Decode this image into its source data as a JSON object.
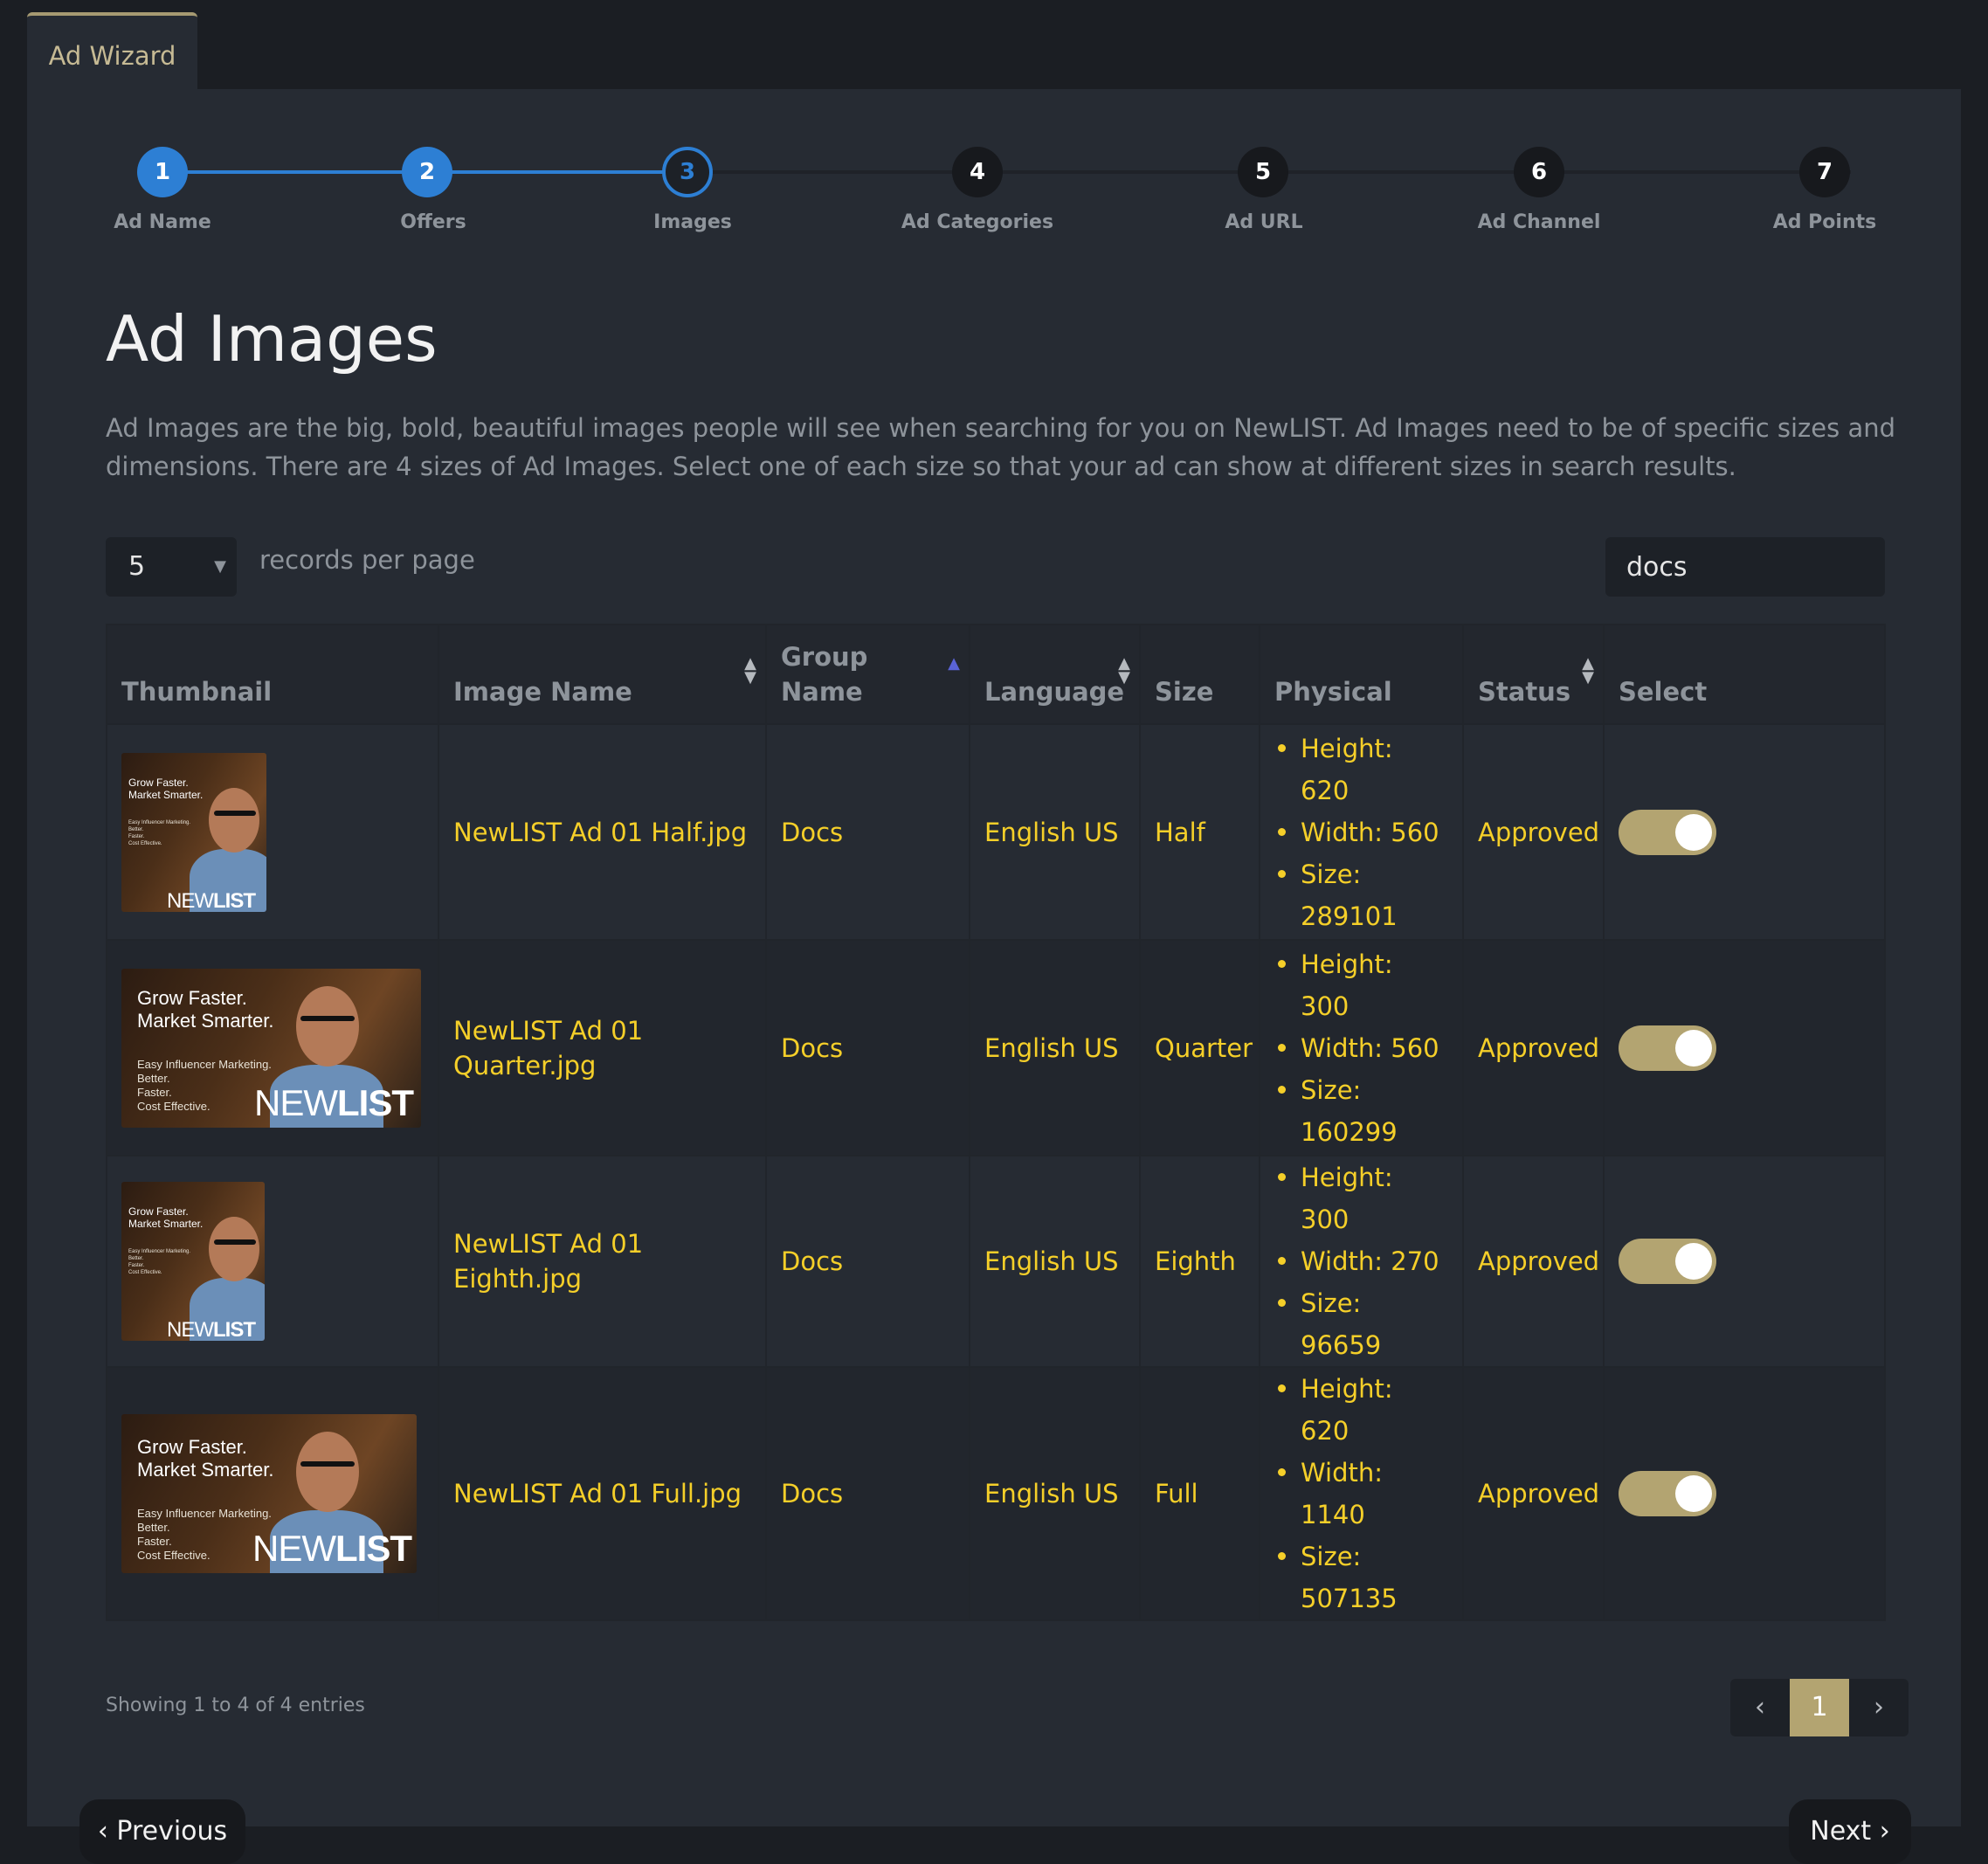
{
  "tab": {
    "label": "Ad Wizard"
  },
  "stepper": {
    "steps": [
      {
        "number": "1",
        "label": "Ad Name"
      },
      {
        "number": "2",
        "label": "Offers"
      },
      {
        "number": "3",
        "label": "Images"
      },
      {
        "number": "4",
        "label": "Ad Categories"
      },
      {
        "number": "5",
        "label": "Ad URL"
      },
      {
        "number": "6",
        "label": "Ad Channel"
      },
      {
        "number": "7",
        "label": "Ad Points"
      }
    ],
    "current_step": 3
  },
  "page": {
    "title": "Ad Images",
    "description": "Ad Images are the big, bold, beautiful images people will see when searching for you on NewLIST. Ad Images need to be of specific sizes and dimensions. There are 4 sizes of Ad Images. Select one of each size so that your ad can show at different sizes in search results."
  },
  "controls": {
    "records_per_page": "5",
    "records_per_page_label": "records per page",
    "search_value": "docs"
  },
  "table": {
    "columns": [
      "Thumbnail",
      "Image Name",
      "Group Name",
      "Language",
      "Size",
      "Physical",
      "Status",
      "Select"
    ],
    "rows": [
      {
        "image_name": "NewLIST Ad 01 Half.jpg",
        "group": "Docs",
        "language": "English US",
        "size": "Half",
        "physical": [
          "Height: 620",
          "Width: 560",
          "Size: 289101"
        ],
        "status": "Approved",
        "selected": true,
        "thumb": {
          "headline_1": "Grow Faster.",
          "headline_2": "Market Smarter.",
          "body": [
            "Easy Influencer Marketing.",
            "Better.",
            "Faster.",
            "Cost Effective."
          ],
          "brand_a": "NEW",
          "brand_b": "LIST"
        }
      },
      {
        "image_name": "NewLIST Ad 01 Quarter.jpg",
        "group": "Docs",
        "language": "English US",
        "size": "Quarter",
        "physical": [
          "Height: 300",
          "Width: 560",
          "Size: 160299"
        ],
        "status": "Approved",
        "selected": true,
        "thumb": {
          "headline_1": "Grow Faster.",
          "headline_2": "Market Smarter.",
          "body": [
            "Easy Influencer Marketing.",
            "Better.",
            "Faster.",
            "Cost Effective."
          ],
          "brand_a": "NEW",
          "brand_b": "LIST"
        }
      },
      {
        "image_name": "NewLIST Ad 01 Eighth.jpg",
        "group": "Docs",
        "language": "English US",
        "size": "Eighth",
        "physical": [
          "Height: 300",
          "Width: 270",
          "Size: 96659"
        ],
        "status": "Approved",
        "selected": true,
        "thumb": {
          "headline_1": "Grow Faster.",
          "headline_2": "Market Smarter.",
          "body": [
            "Easy Influencer Marketing.",
            "Better.",
            "Faster.",
            "Cost Effective."
          ],
          "brand_a": "NEW",
          "brand_b": "LIST"
        }
      },
      {
        "image_name": "NewLIST Ad 01 Full.jpg",
        "group": "Docs",
        "language": "English US",
        "size": "Full",
        "physical": [
          "Height: 620",
          "Width: 1140",
          "Size: 507135"
        ],
        "status": "Approved",
        "selected": true,
        "thumb": {
          "headline_1": "Grow Faster.",
          "headline_2": "Market Smarter.",
          "body": [
            "Easy Influencer Marketing.",
            "Better.",
            "Faster.",
            "Cost Effective."
          ],
          "brand_a": "NEW",
          "brand_b": "LIST"
        }
      }
    ]
  },
  "footer": {
    "info": "Showing 1 to 4 of 4 entries",
    "current_page": "1",
    "prev_icon": "chevron-left-icon",
    "next_icon": "chevron-right-icon"
  },
  "nav_buttons": {
    "previous": "Previous",
    "next": "Next"
  },
  "colors": {
    "accent_blue": "#2d7fd4",
    "gold": "#b3a471",
    "value_yellow": "#f5cf29",
    "status_green": "#68a34e"
  }
}
